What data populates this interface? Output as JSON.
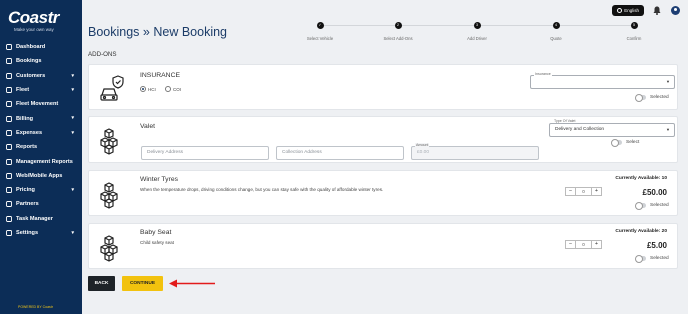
{
  "app": {
    "logo_text": "Coastr",
    "logo_tagline": "Make your own way",
    "powered_by": "POWERED BY Coastr"
  },
  "sidebar": {
    "items": [
      {
        "label": "Dashboard",
        "icon": "dashboard-icon",
        "chevron": false
      },
      {
        "label": "Bookings",
        "icon": "bookings-icon",
        "chevron": false
      },
      {
        "label": "Customers",
        "icon": "customers-icon",
        "chevron": true
      },
      {
        "label": "Fleet",
        "icon": "fleet-icon",
        "chevron": true
      },
      {
        "label": "Fleet Movement",
        "icon": "fleet-movement-icon",
        "chevron": false
      },
      {
        "label": "Billing",
        "icon": "billing-icon",
        "chevron": true
      },
      {
        "label": "Expenses",
        "icon": "expenses-icon",
        "chevron": true
      },
      {
        "label": "Reports",
        "icon": "reports-icon",
        "chevron": false
      },
      {
        "label": "Management Reports",
        "icon": "management-reports-icon",
        "chevron": false
      },
      {
        "label": "Web/Mobile Apps",
        "icon": "apps-icon",
        "chevron": false
      },
      {
        "label": "Pricing",
        "icon": "pricing-icon",
        "chevron": true
      },
      {
        "label": "Partners",
        "icon": "partners-icon",
        "chevron": false
      },
      {
        "label": "Task Manager",
        "icon": "task-manager-icon",
        "chevron": false
      },
      {
        "label": "Settings",
        "icon": "settings-icon",
        "chevron": true
      }
    ]
  },
  "topbar": {
    "language": "English"
  },
  "page": {
    "breadcrumb_root": "Bookings",
    "breadcrumb_sep": "»",
    "breadcrumb_current": "New Booking",
    "section_label": "ADD-ONS"
  },
  "steps": [
    {
      "label": "Select Vehicle",
      "state": "done",
      "marker": "✓"
    },
    {
      "label": "Select Add-Ons",
      "state": "active",
      "marker": "2"
    },
    {
      "label": "Add Driver",
      "state": "pending",
      "marker": "3"
    },
    {
      "label": "Quote",
      "state": "pending",
      "marker": "4"
    },
    {
      "label": "Confirm",
      "state": "pending",
      "marker": "5"
    }
  ],
  "addons": {
    "insurance": {
      "title": "INSURANCE",
      "options": [
        {
          "label": "HCI",
          "selected": true
        },
        {
          "label": "COI",
          "selected": false
        }
      ],
      "select_label": "Insurance",
      "select_value": "",
      "toggle_label": "Selected"
    },
    "valet": {
      "title": "Valet",
      "select_label": "Type Of Valet",
      "select_value": "Delivery and Collection",
      "delivery_placeholder": "Delivery Address",
      "collection_placeholder": "Collection Address",
      "amount_label": "Amount",
      "amount_placeholder": "£0.00",
      "toggle_label": "Select"
    },
    "winter_tyres": {
      "title": "Winter Tyres",
      "description": "When the temperature drops, driving conditions change, but you can stay safe with the quality of affordable winter tyres.",
      "available": "Currently Available: 10",
      "price": "£50.00",
      "qty": "0",
      "toggle_label": "Selected"
    },
    "baby_seat": {
      "title": "Baby Seat",
      "description": "Child safety seat",
      "available": "Currently Available: 20",
      "price": "£5.00",
      "qty": "0",
      "toggle_label": "Selected"
    }
  },
  "actions": {
    "back_label": "BACK",
    "continue_label": "CONTINUE"
  },
  "colors": {
    "sidebar_bg": "#0c2d57",
    "accent_yellow": "#f2c20e",
    "annotation_red": "#e21b1b"
  }
}
